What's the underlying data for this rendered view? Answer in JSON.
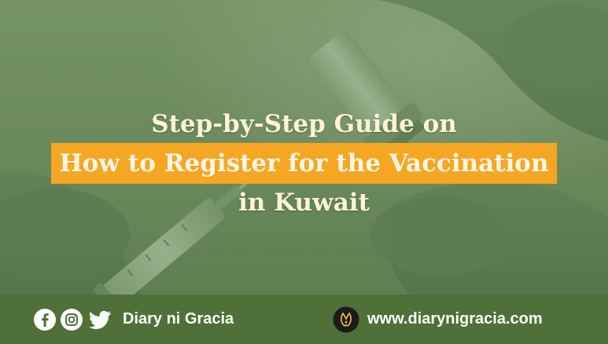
{
  "hero": {
    "background_photo": "vaccine-vial-and-syringe-in-gloved-hands",
    "overlay_color": "#6b8a5b"
  },
  "title": {
    "line1": "Step-by-Step Guide on",
    "line2": "How to Register for the Vaccination",
    "line3": "in Kuwait",
    "text_color": "#fff2d9",
    "highlight_color": "#f5a623"
  },
  "footer": {
    "background_color": "#4f7039",
    "social_icons": [
      "facebook-icon",
      "instagram-icon",
      "twitter-icon"
    ],
    "brand_name": "Diary ni Gracia",
    "logo_icon": "brand-logo-icon",
    "website": "www.diarynigracia.com"
  }
}
